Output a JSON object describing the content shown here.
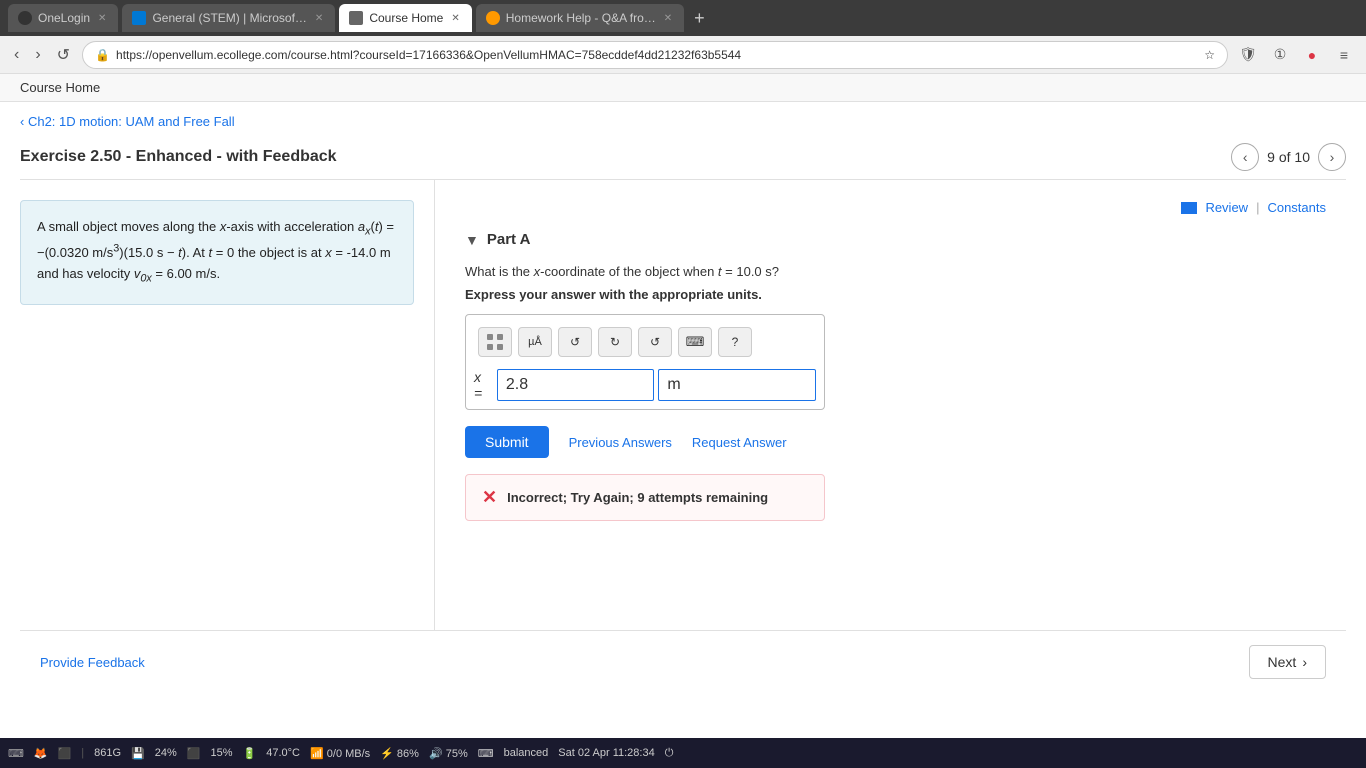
{
  "browser": {
    "tabs": [
      {
        "id": "onelogin",
        "label": "OneLogin",
        "active": false,
        "icon": "onelogin"
      },
      {
        "id": "microsoft",
        "label": "General (STEM) | Microsof…",
        "active": false,
        "icon": "microsoft"
      },
      {
        "id": "coursehome",
        "label": "Course Home",
        "active": true,
        "icon": "coursehome"
      },
      {
        "id": "homework",
        "label": "Homework Help - Q&A fro…",
        "active": false,
        "icon": "homework"
      }
    ],
    "url": "https://openvellum.ecollege.com/course.html?courseId=17166336&OpenVellumHMAC=758ecddef4dd21232f63b5544",
    "new_tab_label": "+"
  },
  "page_header": {
    "label": "Course Home"
  },
  "breadcrumb": {
    "text": "Ch2: 1D motion: UAM and Free Fall",
    "chevron": "‹"
  },
  "exercise": {
    "title": "Exercise 2.50 - Enhanced - with Feedback",
    "pagination": {
      "current": "9 of 10",
      "prev_label": "‹",
      "next_label": "›"
    }
  },
  "toolbar": {
    "review_label": "Review",
    "pipe": "|",
    "constants_label": "Constants"
  },
  "part": {
    "label": "Part A",
    "arrow": "▼"
  },
  "problem": {
    "text_html": "A small object moves along the x-axis with acceleration a<sub>x</sub>(t) = −(0.0320 m/s<sup>3</sup>)(15.0 s − t). At t = 0 the object is at x = -14.0 m and has velocity v<sub>0x</sub> = 6.00 m/s."
  },
  "question": {
    "text": "What is the x-coordinate of the object when t = 10.0 s?",
    "express_label": "Express your answer with the appropriate units."
  },
  "math_input": {
    "equals_label": "x =",
    "value": "2.8",
    "unit": "m",
    "toolbar_buttons": [
      {
        "id": "matrix",
        "symbol": "⊞",
        "label": "matrix"
      },
      {
        "id": "micro",
        "symbol": "µÅ",
        "label": "micro"
      },
      {
        "id": "undo",
        "symbol": "↺",
        "label": "undo"
      },
      {
        "id": "redo",
        "symbol": "↻",
        "label": "redo"
      },
      {
        "id": "refresh",
        "symbol": "↺",
        "label": "refresh"
      },
      {
        "id": "keyboard",
        "symbol": "⌨",
        "label": "keyboard"
      },
      {
        "id": "help",
        "symbol": "?",
        "label": "help"
      }
    ]
  },
  "actions": {
    "submit_label": "Submit",
    "previous_answers_label": "Previous Answers",
    "request_answer_label": "Request Answer"
  },
  "feedback": {
    "error_icon": "✕",
    "text": "Incorrect; Try Again; 9 attempts remaining"
  },
  "footer": {
    "provide_feedback_label": "Provide Feedback",
    "next_label": "Next",
    "next_arrow": "›"
  },
  "taskbar": {
    "items": [
      "861G",
      "24%",
      "15%",
      "47.0°C",
      "0/0 MB/s",
      "86%",
      "75%",
      "balanced",
      "Sat 02 Apr 11:28:34"
    ]
  }
}
